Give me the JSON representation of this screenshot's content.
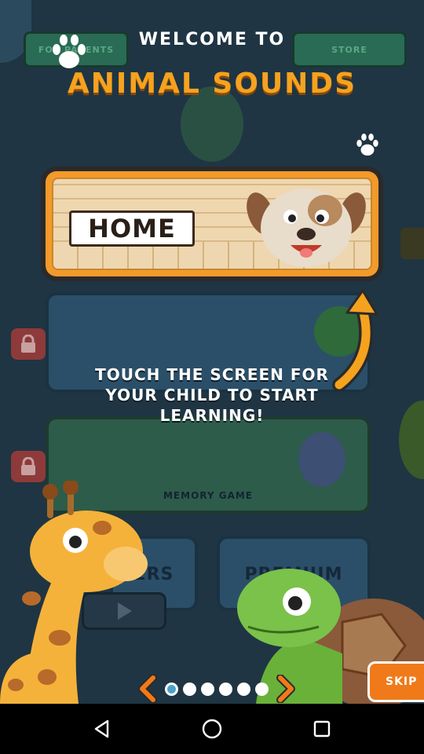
{
  "app": {
    "welcome_text": "WELCOME TO",
    "title": "ANIMAL SOUNDS"
  },
  "background": {
    "top_left_button": "FOR PARENTS",
    "top_right_button": "STORE",
    "memory_game_label": "MEMORY GAME",
    "card_left_label": "ERS",
    "card_right_label": "PREMIUM"
  },
  "home_card": {
    "label": "HOME"
  },
  "hint": {
    "text": "TOUCH THE SCREEN FOR YOUR CHILD TO START LEARNING!"
  },
  "pager": {
    "total_pages": 6,
    "current_page": 1,
    "prev_icon": "chevron-left-icon",
    "next_icon": "chevron-right-icon"
  },
  "skip_button": {
    "label": "SKIP"
  },
  "navbar": {
    "back_icon": "back-triangle-icon",
    "home_icon": "home-circle-icon",
    "recents_icon": "recents-square-icon"
  },
  "colors": {
    "title_orange": "#f5a21f",
    "accent_orange": "#f07a1a",
    "active_dot": "#4aa3c9",
    "overlay_bg": "#1f3543"
  }
}
